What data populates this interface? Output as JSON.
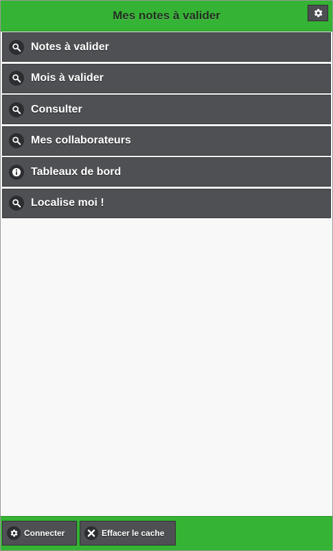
{
  "header": {
    "title": "Mes notes à valider",
    "settings_icon": "gear-icon"
  },
  "menu": {
    "items": [
      {
        "label": "Notes à valider",
        "icon": "search-icon"
      },
      {
        "label": "Mois à valider",
        "icon": "search-icon"
      },
      {
        "label": "Consulter",
        "icon": "search-icon"
      },
      {
        "label": "Mes collaborateurs",
        "icon": "search-icon"
      },
      {
        "label": "Tableaux de bord",
        "icon": "info-icon"
      },
      {
        "label": "Localise moi !",
        "icon": "search-icon"
      }
    ]
  },
  "footer": {
    "connect_label": "Connecter",
    "connect_icon": "gear-icon",
    "clear_cache_label": "Effacer le cache",
    "clear_cache_icon": "close-icon"
  },
  "colors": {
    "accent_green": "#35b334",
    "menu_item_bg": "#4f5054",
    "content_bg": "#f8f8f8"
  }
}
